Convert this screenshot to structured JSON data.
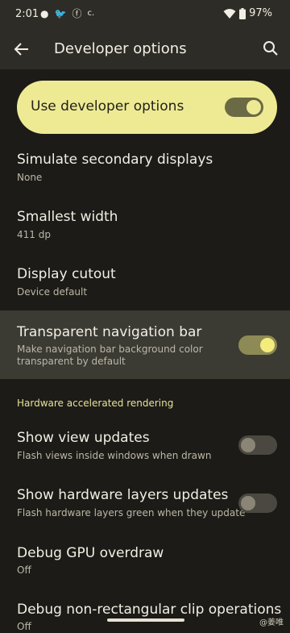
{
  "status_bar": {
    "time": "2:01",
    "icons": [
      "notification-icon",
      "twitter-icon",
      "app-icon",
      "cast-icon"
    ],
    "battery": "97%"
  },
  "app_bar": {
    "title": "Developer options"
  },
  "master_switch": {
    "label": "Use developer options",
    "checked": true
  },
  "settings": {
    "simulate": {
      "title": "Simulate secondary displays",
      "subtitle": "None"
    },
    "smallest": {
      "title": "Smallest width",
      "subtitle": "411 dp"
    },
    "cutout": {
      "title": "Display cutout",
      "subtitle": "Device default"
    },
    "transparent_nav": {
      "title": "Transparent navigation bar",
      "subtitle_line1": "Make navigation bar background color",
      "subtitle_line2": "transparent by default",
      "checked": true
    },
    "section_hw": "Hardware accelerated rendering",
    "view_updates": {
      "title": "Show view updates",
      "subtitle": "Flash views inside windows when drawn",
      "checked": false
    },
    "hw_layers": {
      "title": "Show hardware layers updates",
      "subtitle": "Flash hardware layers green when they update",
      "checked": false
    },
    "gpu_overdraw": {
      "title": "Debug GPU overdraw",
      "subtitle": "Off"
    },
    "clip_ops": {
      "title": "Debug non-rectangular clip operations",
      "subtitle": "Off"
    }
  },
  "watermark": "@姜唯"
}
